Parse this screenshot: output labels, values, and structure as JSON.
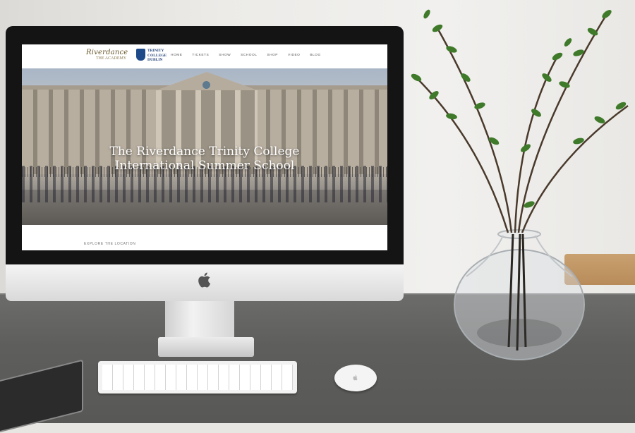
{
  "website": {
    "logo_riverdance": "Riverdance",
    "logo_academy": "THE ACADEMY",
    "logo_trinity_line1": "TRINITY",
    "logo_trinity_line2": "COLLEGE",
    "logo_trinity_line3": "DUBLIN",
    "menu": [
      "HOME",
      "TICKETS",
      "SHOW",
      "SCHOOL",
      "SHOP",
      "VIDEO",
      "BLOG"
    ],
    "hero_title_line1": "The Riverdance Trinity College",
    "hero_title_line2": "International Summer School",
    "explore_link": "EXPLORE THE LOCATION"
  },
  "colors": {
    "desk": "#5e5e5c",
    "wall": "#ecebe8",
    "bezel": "#141414",
    "trinity_blue": "#1f3f74"
  },
  "icons": [
    "apple-logo-icon"
  ]
}
